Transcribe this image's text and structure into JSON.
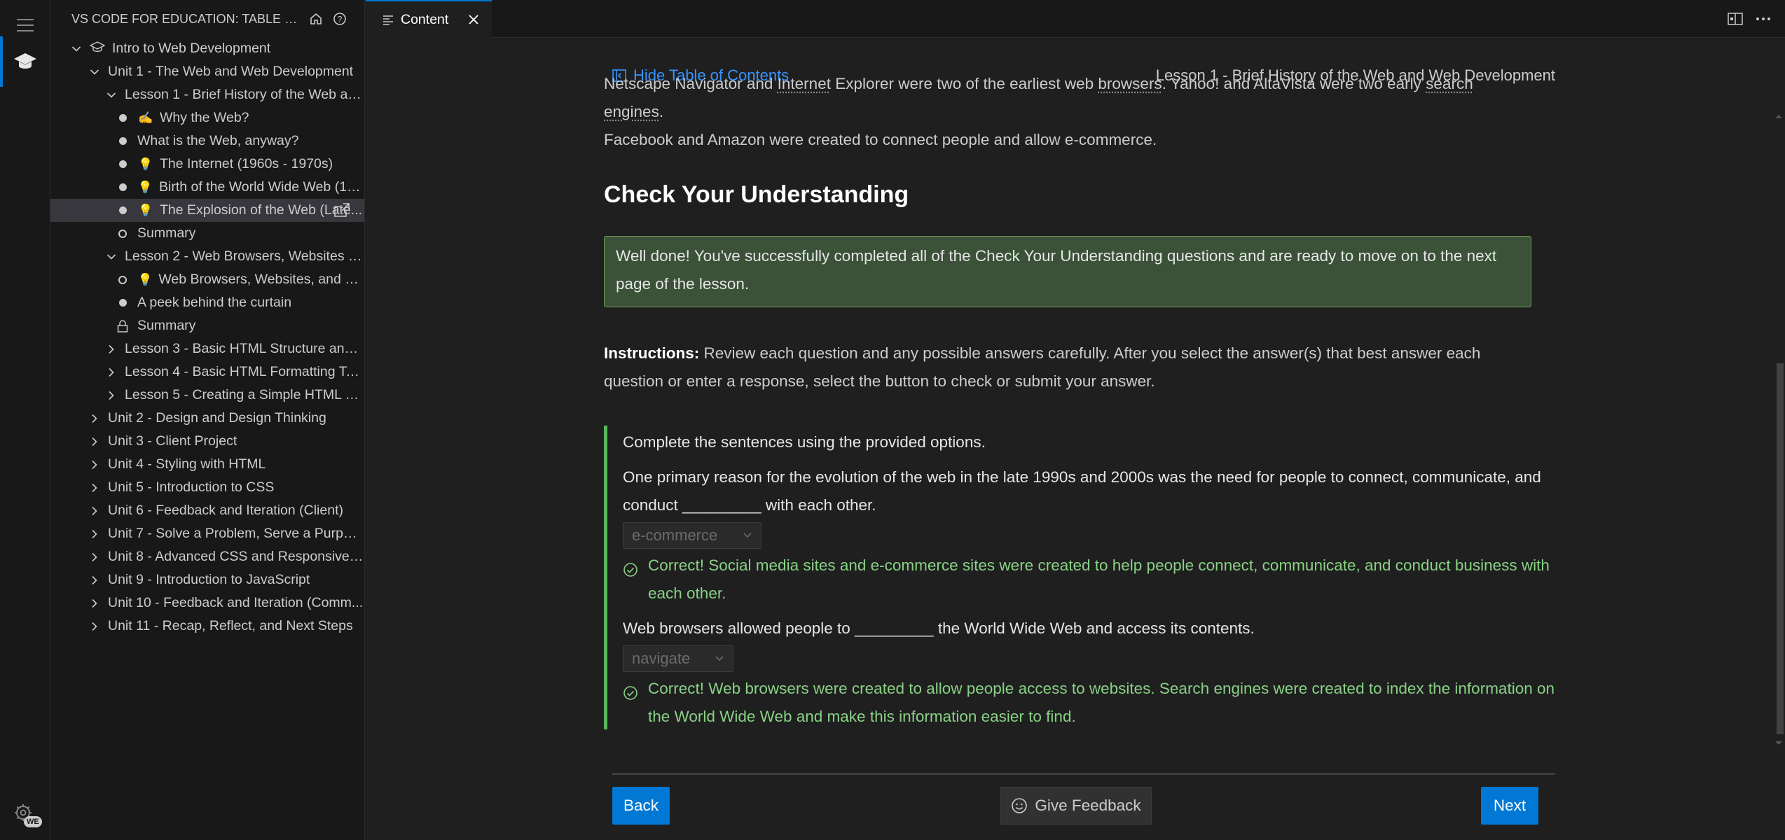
{
  "sidebar": {
    "title": "VS CODE FOR EDUCATION: TABLE OF CON...",
    "tree": [
      {
        "label": "Intro to Web Development",
        "indent": 0,
        "chev": "down",
        "icon": "mortarboard"
      },
      {
        "label": "Unit 1 - The Web and Web Development",
        "indent": 1,
        "chev": "down"
      },
      {
        "label": "Lesson 1 - Brief History of the Web and ...",
        "indent": 2,
        "chev": "down"
      },
      {
        "label": "Why the Web?",
        "indent": 3,
        "bullet": "filled",
        "emoji": "✍️"
      },
      {
        "label": "What is the Web, anyway?",
        "indent": 3,
        "bullet": "filled"
      },
      {
        "label": "The Internet (1960s - 1970s)",
        "indent": 3,
        "bullet": "filled",
        "emoji": "💡"
      },
      {
        "label": "Birth of the World Wide Web (199...",
        "indent": 3,
        "bullet": "filled",
        "emoji": "💡"
      },
      {
        "label": "The Explosion of the Web (Late...",
        "indent": 3,
        "bullet": "filled",
        "emoji": "💡",
        "selected": true
      },
      {
        "label": "Summary",
        "indent": 3,
        "bullet": "open"
      },
      {
        "label": "Lesson 2 - Web Browsers, Websites and...",
        "indent": 2,
        "chev": "down"
      },
      {
        "label": "Web Browsers, Websites, and Dev...",
        "indent": 3,
        "bullet": "open",
        "emoji": "💡"
      },
      {
        "label": "A peek behind the curtain",
        "indent": 3,
        "bullet": "filled"
      },
      {
        "label": "Summary",
        "indent": 3,
        "bullet": "lock"
      },
      {
        "label": "Lesson 3 - Basic HTML Structure and Tags",
        "indent": 2,
        "chev": "right"
      },
      {
        "label": "Lesson 4 - Basic HTML Formatting Tags ...",
        "indent": 2,
        "chev": "right"
      },
      {
        "label": "Lesson 5 - Creating a Simple HTML page",
        "indent": 2,
        "chev": "right"
      },
      {
        "label": "Unit 2 - Design and Design Thinking",
        "indent": 1,
        "chev": "right"
      },
      {
        "label": "Unit 3 - Client Project",
        "indent": 1,
        "chev": "right"
      },
      {
        "label": "Unit 4 - Styling with HTML",
        "indent": 1,
        "chev": "right"
      },
      {
        "label": "Unit 5 - Introduction to CSS",
        "indent": 1,
        "chev": "right"
      },
      {
        "label": "Unit 6 - Feedback and Iteration (Client)",
        "indent": 1,
        "chev": "right"
      },
      {
        "label": "Unit 7 - Solve a Problem, Serve a Purpose",
        "indent": 1,
        "chev": "right"
      },
      {
        "label": "Unit 8 - Advanced CSS and Responsive ...",
        "indent": 1,
        "chev": "right"
      },
      {
        "label": "Unit 9 - Introduction to JavaScript",
        "indent": 1,
        "chev": "right"
      },
      {
        "label": "Unit 10 - Feedback and Iteration (Comm...",
        "indent": 1,
        "chev": "right"
      },
      {
        "label": "Unit 11 - Recap, Reflect, and Next Steps",
        "indent": 1,
        "chev": "right"
      }
    ]
  },
  "activity": {
    "badge": "WE"
  },
  "tab": {
    "label": "Content"
  },
  "header": {
    "toc_link": "Hide Table of Contents",
    "lesson_title": "Lesson 1 - Brief History of the Web and Web Development"
  },
  "article": {
    "intro_a": "Netscape Navigator and ",
    "intro_b": "Internet",
    "intro_c": " Explorer were two of the earliest web ",
    "intro_d": "browsers",
    "intro_e": ". Yahoo! and AltaVista were two early ",
    "intro_f": "search engines",
    "intro_g": ".",
    "intro_line2": "Facebook and Amazon were created to connect people and allow e-commerce.",
    "heading": "Check Your Understanding",
    "success": "Well done! You've successfully completed all of the Check Your Understanding questions and are ready to move on to the next page of the lesson.",
    "instr_label": "Instructions:",
    "instr_text": " Review each question and any possible answers carefully. After you select the answer(s) that best answer each question or enter a response, select the button to check or submit your answer."
  },
  "question": {
    "prompt": "Complete the sentences using the provided options.",
    "q1": "One primary reason for the evolution of the web in the late 1990s and 2000s was the need for people to connect, communicate, and conduct _________ with each other.",
    "q1_answer": "e-commerce",
    "q1_feedback": "Correct! Social media sites and e-commerce sites were created to help people connect, communicate, and conduct business with each other.",
    "q2": "Web browsers allowed people to _________ the World Wide Web and access its contents.",
    "q2_answer": "navigate",
    "q2_feedback": "Correct! Web browsers were created to allow people access to websites. Search engines were created to index the information on the World Wide Web and make this information easier to find."
  },
  "buttons": {
    "back": "Back",
    "feedback": "Give Feedback",
    "next": "Next"
  },
  "colors": {
    "accent": "#0078d4",
    "link": "#3794ff",
    "success": "#89d185",
    "success_bg": "#3b5238"
  }
}
